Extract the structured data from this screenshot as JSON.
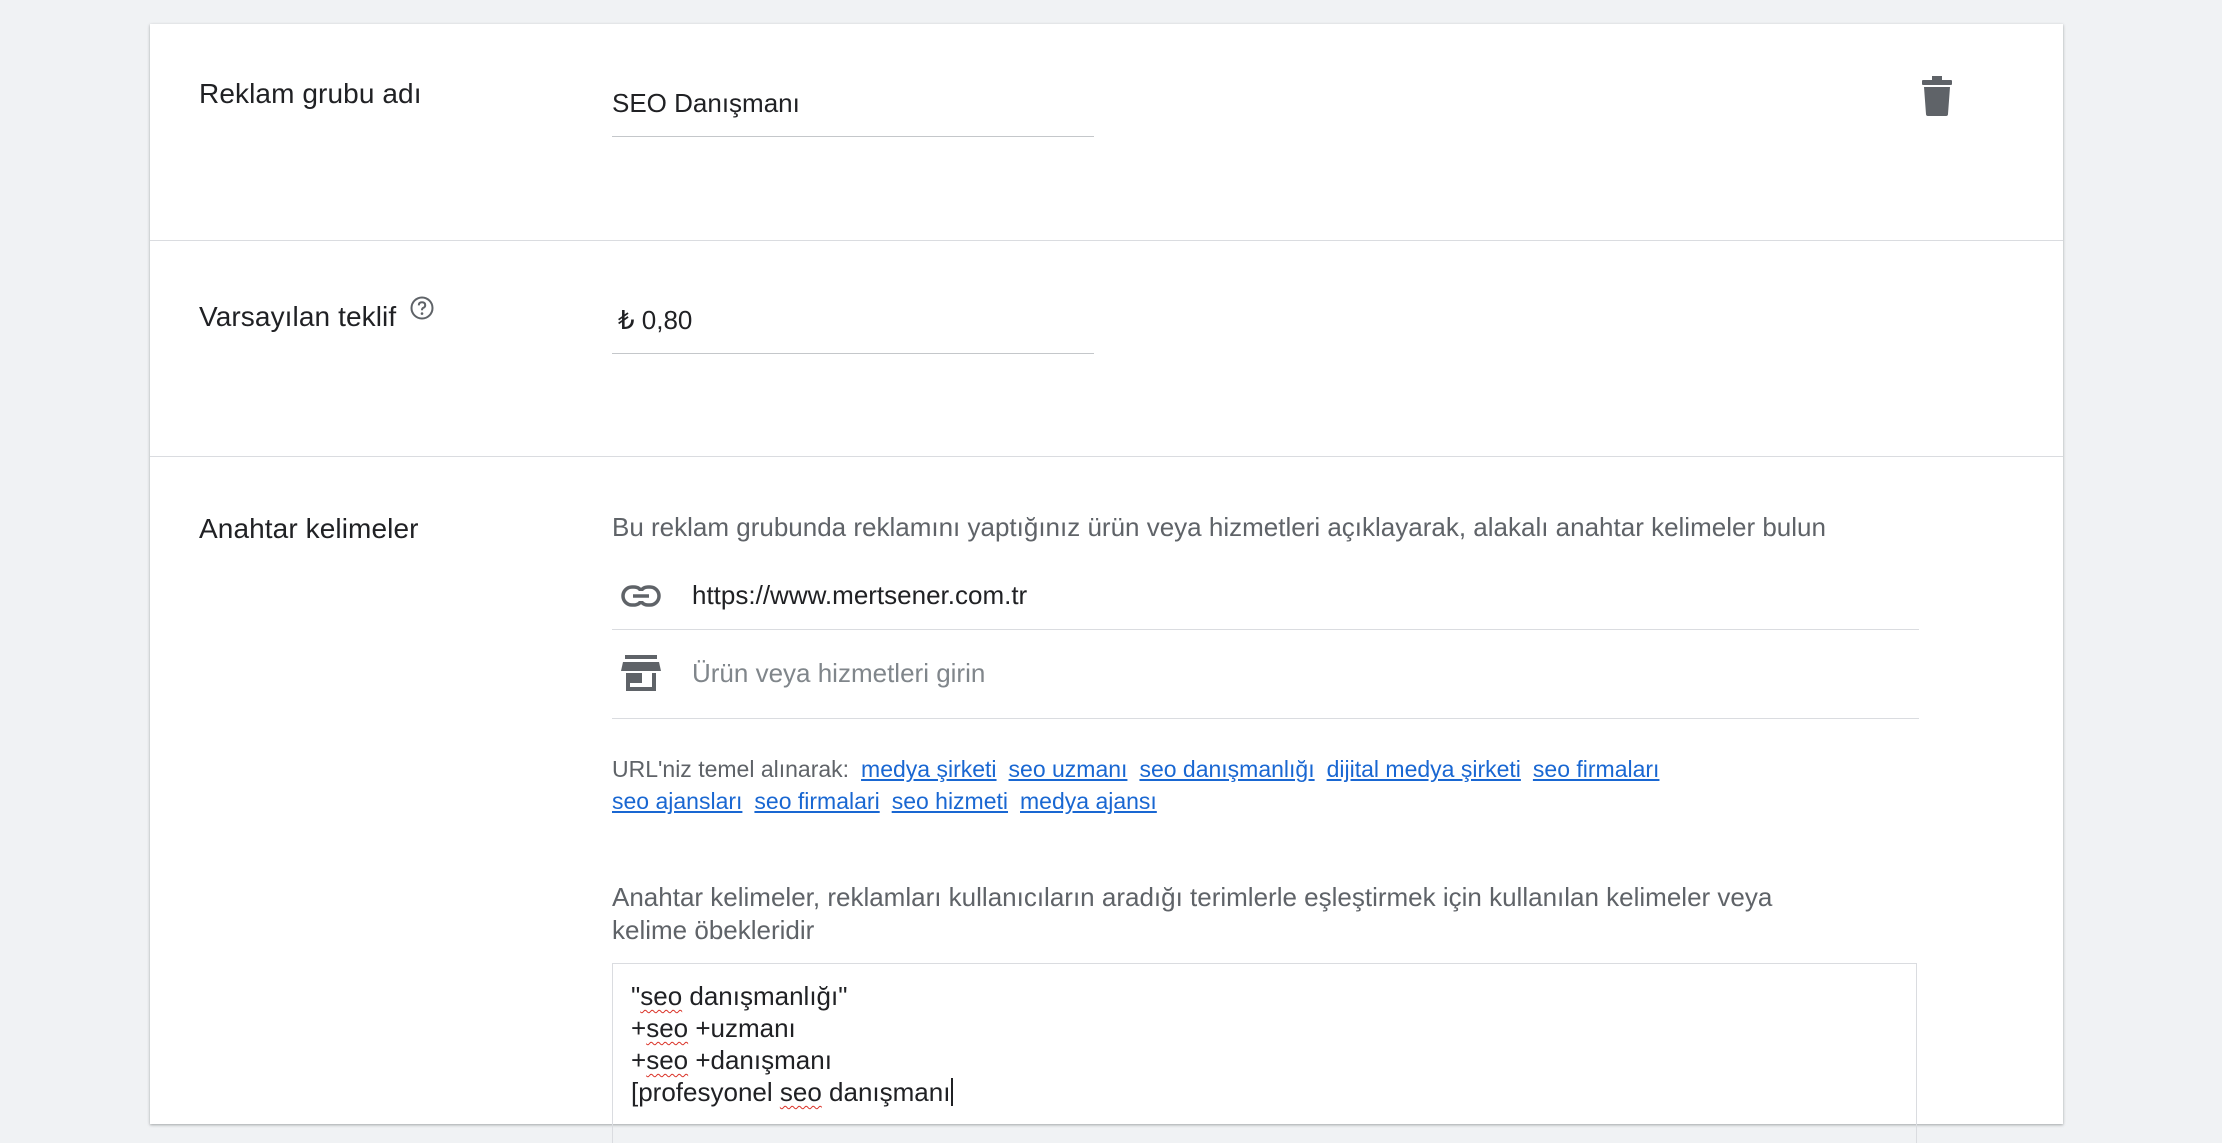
{
  "ad_group_name": {
    "label": "Reklam grubu adı",
    "value": "SEO Danışmanı"
  },
  "default_bid": {
    "label": "Varsayılan teklif",
    "value": "₺ 0,80"
  },
  "keywords": {
    "label": "Anahtar kelimeler",
    "description": "Bu reklam grubunda reklamını yaptığınız ürün veya hizmetleri açıklayarak, alakalı anahtar kelimeler bulun",
    "url_value": "https://www.mertsener.com.tr",
    "product_placeholder": "Ürün veya hizmetleri girin",
    "suggestions_prefix": "URL'niz temel alınarak:",
    "suggestions": [
      "medya şirketi",
      "seo uzmanı",
      "seo danışmanlığı",
      "dijital medya şirketi",
      "seo firmaları",
      "seo ajansları",
      "seo firmalari",
      "seo hizmeti",
      "medya ajansı"
    ],
    "info_line1": "Anahtar kelimeler, reklamları kullanıcıların aradığı terimlerle eşleştirmek için kullanılan kelimeler veya",
    "info_line2": "kelime öbekleridir",
    "entered": [
      "\"seo danışmanlığı\"",
      "+seo +uzmanı",
      "+seo +danışmanı",
      "[profesyonel seo danışmanı"
    ]
  },
  "icons": {
    "delete": "trash-icon",
    "help": "help-circle-icon",
    "url": "link-icon",
    "product": "storefront-icon"
  }
}
